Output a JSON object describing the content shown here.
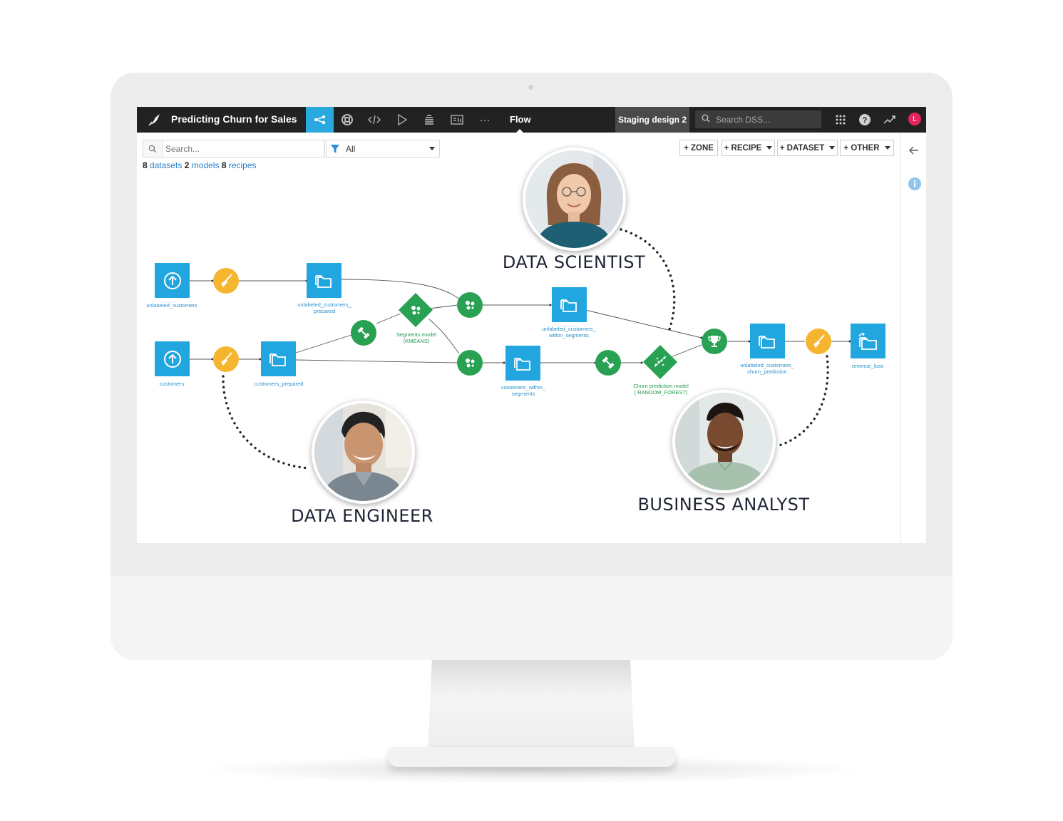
{
  "app": {
    "project_title": "Predicting Churn for Sales",
    "active_view": "Flow",
    "instance_badge": "Staging design 2",
    "search_placeholder": "Search DSS...",
    "user_initial": "L",
    "nav_icons": [
      "flow-icon",
      "lifebuoy-icon",
      "code-icon",
      "run-icon",
      "stack-icon",
      "dashboard-icon",
      "more-icon"
    ],
    "right_icons": [
      "apps-grid-icon",
      "help-icon",
      "trend-icon",
      "avatar"
    ]
  },
  "toolbar": {
    "search_placeholder": "Search...",
    "filter_value": "All",
    "buttons": [
      "+ ZONE",
      "+ RECIPE",
      "+ DATASET",
      "+ OTHER"
    ]
  },
  "counts": {
    "datasets_n": "8",
    "datasets_label": "datasets",
    "models_n": "2",
    "models_label": "models",
    "recipes_n": "8",
    "recipes_label": "recipes"
  },
  "flow": {
    "datasets": {
      "unlabeled_customers": "unlabeled_customers",
      "unlabeled_customers_prepared": "unlabeled_customers_\nprepared",
      "customers": "customers",
      "customers_prepared": "customers_prepared",
      "unlabeled_customers_within_segments": "unlabeled_customers_\nwithin_segments",
      "customers_within_segments": "customers_within_\nsegments",
      "unlabeled_customers_churn_prediction": "unlabeled_customers_\nchurn_prediction",
      "revenue_loss": "revenue_loss"
    },
    "models": {
      "segments": "Segments model\n(KMEANS)",
      "churn": "Churn prediction model\n( RANDOM_FOREST)"
    }
  },
  "personas": {
    "data_scientist": "DATA SCIENTIST",
    "data_engineer": "DATA ENGINEER",
    "business_analyst": "BUSINESS ANALYST"
  },
  "colors": {
    "topbar": "#222222",
    "accent": "#2aa9e1",
    "dataset": "#22a6e0",
    "prepare_recipe": "#f6b52f",
    "ml_recipe": "#29a153",
    "avatar": "#e5245d"
  }
}
